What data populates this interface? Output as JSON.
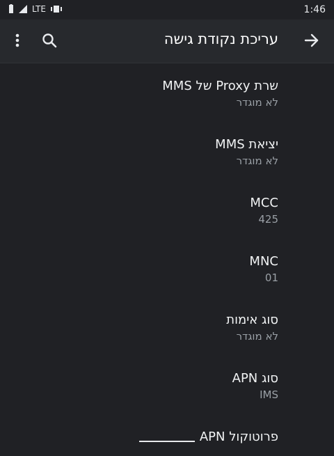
{
  "status_bar": {
    "network_label": "LTE",
    "time": "1:46"
  },
  "toolbar": {
    "title": "עריכת נקודת גישה",
    "back_icon": "arrow-forward-icon",
    "search_icon": "search-icon",
    "more_icon": "more-vert-icon"
  },
  "items": [
    {
      "title": "שרת Proxy של MMS",
      "value": "לא מוגדר"
    },
    {
      "title": "יציאת MMS",
      "value": "לא מוגדר"
    },
    {
      "title": "MCC",
      "value": "425"
    },
    {
      "title": "MNC",
      "value": "01"
    },
    {
      "title": "סוג אימות",
      "value": "לא מוגדר"
    },
    {
      "title": "סוג APN",
      "value": "IMS"
    },
    {
      "title": "פרוטוקול APN"
    }
  ],
  "colors": {
    "background": "#202125",
    "toolbar": "#27292d",
    "primary_text": "#f1f3f4",
    "secondary_text": "#9aa0a6"
  }
}
